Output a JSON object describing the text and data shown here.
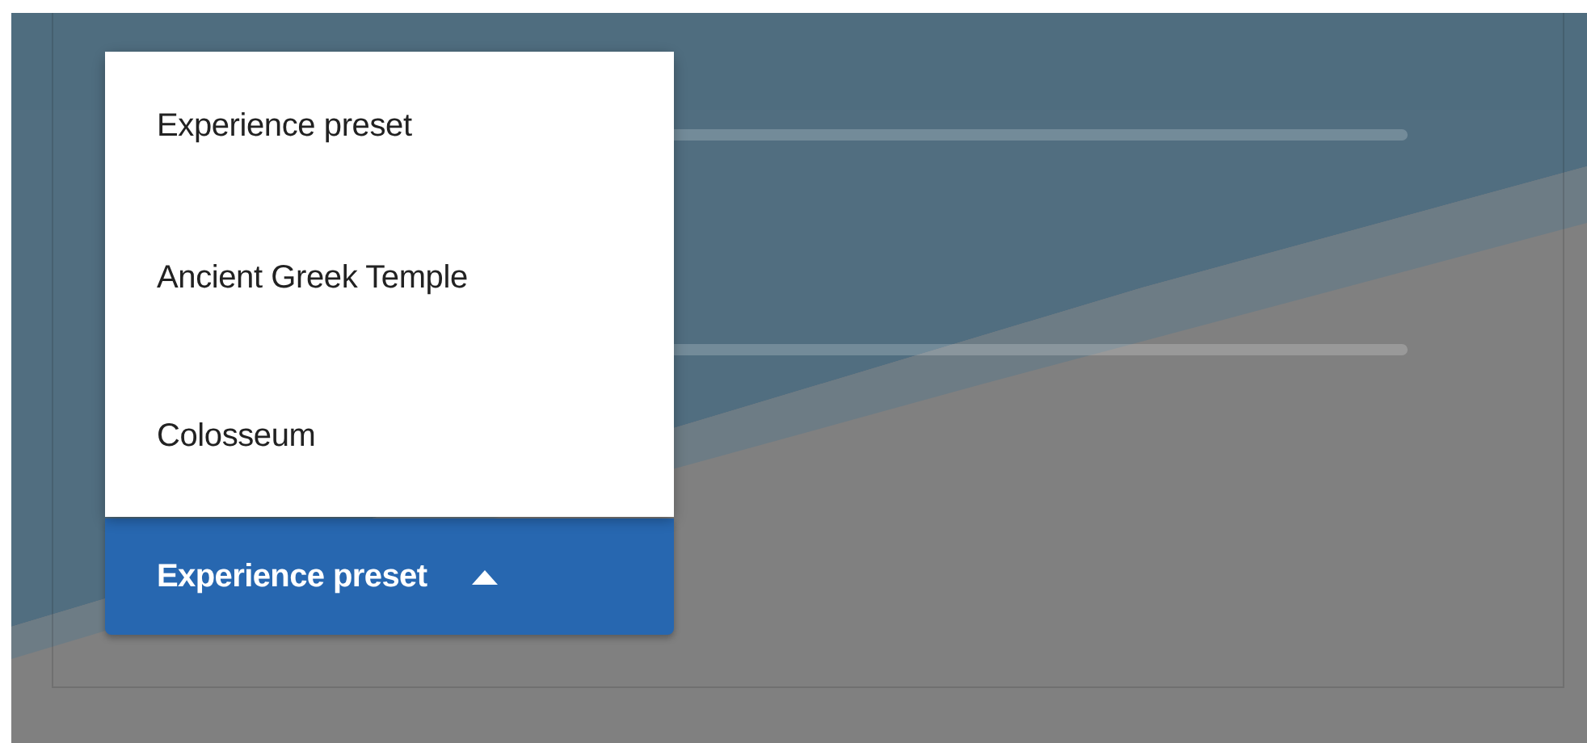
{
  "sliders": [
    {
      "kind": "track"
    },
    {
      "kind": "track"
    }
  ],
  "preset_dropdown": {
    "label": "Experience preset",
    "expanded": true,
    "options": [
      {
        "label": "Experience preset"
      },
      {
        "label": "Ancient Greek Temple"
      },
      {
        "label": "Colosseum"
      }
    ]
  }
}
